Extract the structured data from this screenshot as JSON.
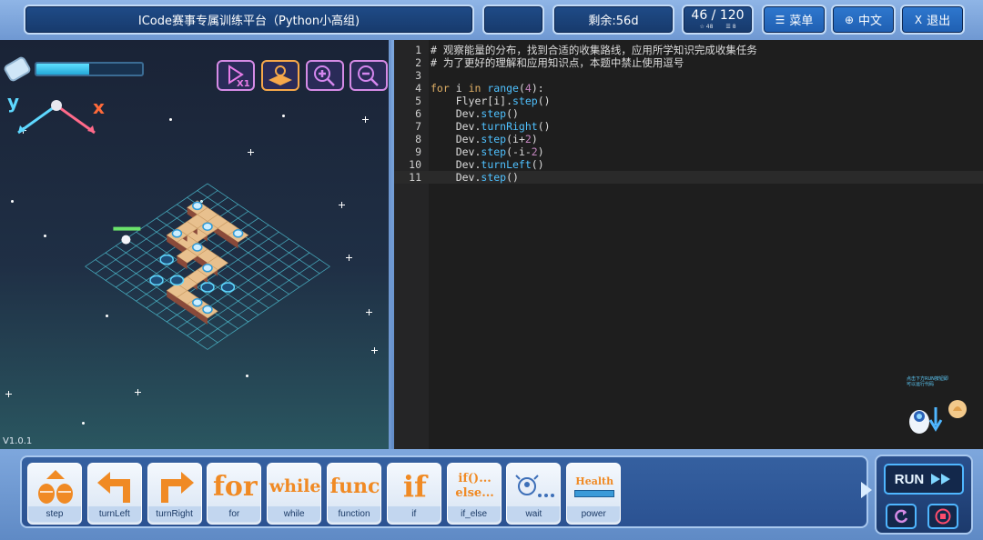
{
  "header": {
    "title": "ICode赛事专属训练平台（Python小高组)",
    "blank_box": "",
    "remaining": "剩余:56d",
    "progress": {
      "current_total": "46 / 120",
      "stat1": "48",
      "stat2": "8"
    },
    "menu_label": "菜单",
    "lang_label": "中文",
    "exit_label": "退出",
    "icons": {
      "menu": "hamburger-icon",
      "lang": "globe-icon",
      "exit": "close-icon"
    }
  },
  "game": {
    "version": "V1.0.1",
    "energy_level": 0.5,
    "axis_y": "y",
    "axis_x": "x",
    "tools": [
      "speed-x1-icon",
      "map-icon",
      "zoom-in-icon",
      "zoom-out-icon"
    ],
    "speed_label": "X1"
  },
  "editor": {
    "lines": [
      {
        "n": "1",
        "text": "# 观察能量的分布，找到合适的收集路线，应用所学知识完成收集任务"
      },
      {
        "n": "2",
        "text": "# 为了更好的理解和应用知识点，本题中禁止使用逗号"
      },
      {
        "n": "3",
        "text": ""
      },
      {
        "n": "4",
        "text": "for i in range(4):"
      },
      {
        "n": "5",
        "text": "    Flyer[i].step()"
      },
      {
        "n": "6",
        "text": "    Dev.step()"
      },
      {
        "n": "7",
        "text": "    Dev.turnRight()"
      },
      {
        "n": "8",
        "text": "    Dev.step(i+2)"
      },
      {
        "n": "9",
        "text": "    Dev.step(-i-2)"
      },
      {
        "n": "10",
        "text": "    Dev.turnLeft()"
      },
      {
        "n": "11",
        "text": "    Dev.step()"
      }
    ],
    "helper_tip": "点击下方RUN按钮即可以运行代码"
  },
  "blocks": [
    {
      "label": "step",
      "icon": "step-icon"
    },
    {
      "label": "turnLeft",
      "icon": "turn-left-icon"
    },
    {
      "label": "turnRight",
      "icon": "turn-right-icon"
    },
    {
      "label": "for",
      "icon": "for-icon",
      "glyph": "for"
    },
    {
      "label": "while",
      "icon": "while-icon",
      "glyph": "while"
    },
    {
      "label": "function",
      "icon": "function-icon",
      "glyph": "func"
    },
    {
      "label": "if",
      "icon": "if-icon",
      "glyph": "if"
    },
    {
      "label": "if_else",
      "icon": "if-else-icon",
      "glyph": "if()...",
      "glyph2": "else..."
    },
    {
      "label": "wait",
      "icon": "wait-icon"
    },
    {
      "label": "power",
      "icon": "power-icon",
      "glyph": "Health"
    }
  ],
  "run": {
    "label": "RUN",
    "icons": [
      "fast-forward-icon",
      "refresh-icon",
      "stop-icon"
    ]
  },
  "colors": {
    "accent": "#f08a24",
    "panel": "#2b5292",
    "code_bg": "#1e1e1e",
    "comment": "#4cd3c8"
  }
}
